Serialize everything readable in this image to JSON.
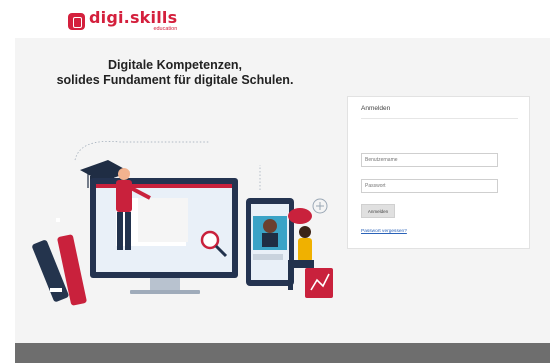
{
  "brand": {
    "name": "digi.skills",
    "sub": "education",
    "color": "#d4203d"
  },
  "headline": {
    "line1": "Digitale Kompetenzen,",
    "line2": "solides Fundament für digitale Schulen."
  },
  "login": {
    "title": "Anmelden",
    "username_placeholder": "Benutzername",
    "password_placeholder": "Passwort",
    "submit_label": "Anmelden",
    "forgot_label": "Passwort vergessen?"
  },
  "icons": [
    "logo-mark-icon",
    "graduation-cap-icon",
    "magnifier-icon",
    "plus-icon",
    "chart-icon"
  ]
}
